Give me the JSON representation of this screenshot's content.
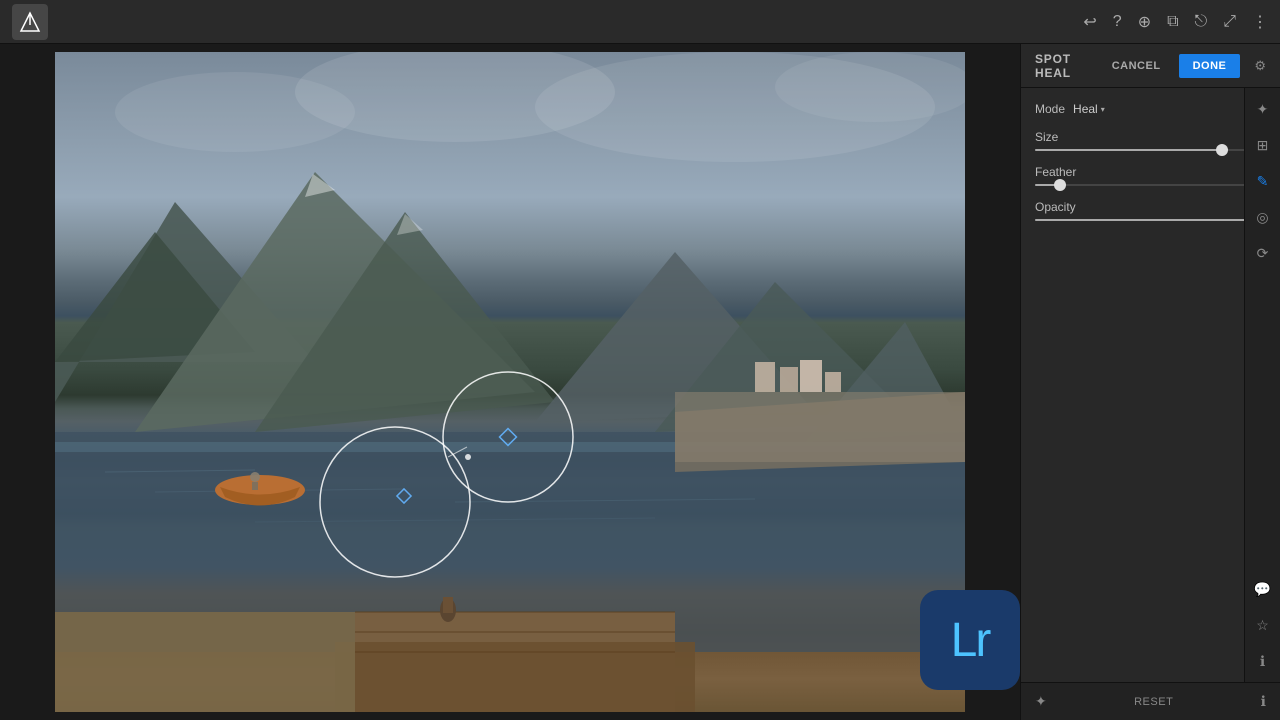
{
  "app": {
    "logo_text": "Lr"
  },
  "topbar": {
    "icons": [
      "undo",
      "help",
      "add",
      "split-view",
      "share",
      "expand",
      "more"
    ]
  },
  "spot_heal_panel": {
    "title": "SPOT HEAL",
    "cancel_label": "CANCEL",
    "done_label": "DONE",
    "mode_label": "Mode",
    "mode_value": "Heal",
    "size_label": "Size",
    "size_value": "81",
    "size_percent": 81,
    "feather_label": "Feather",
    "feather_value": "11",
    "feather_percent": 11,
    "opacity_label": "Opacity",
    "opacity_value": "100",
    "opacity_percent": 100
  },
  "bottom_bar": {
    "reset_label": "RESET"
  },
  "right_sidebar": {
    "icons": [
      "auto-enhance",
      "crop",
      "heal",
      "filters",
      "history",
      "comment",
      "favorite",
      "info"
    ]
  }
}
